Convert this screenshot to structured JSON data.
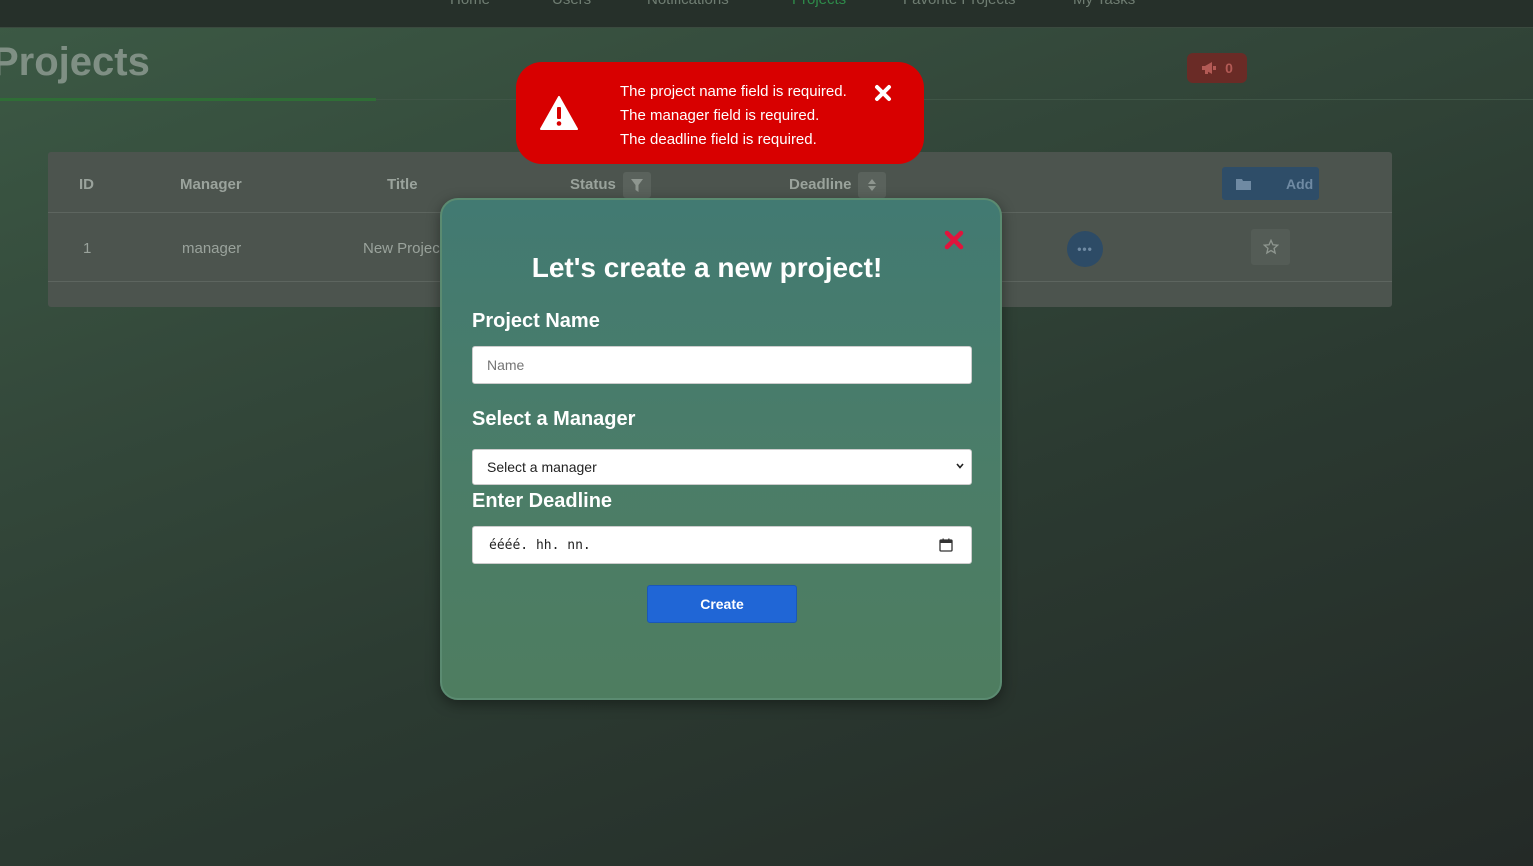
{
  "nav": {
    "items": [
      {
        "label": "Home",
        "active": false
      },
      {
        "label": "Users",
        "active": false
      },
      {
        "label": "Notifications",
        "active": false
      },
      {
        "label": "Projects",
        "active": true
      },
      {
        "label": "Favorite Projects",
        "active": false
      },
      {
        "label": "My Tasks",
        "active": false
      }
    ]
  },
  "header": {
    "title": "Projects",
    "announcement_count": "0"
  },
  "table": {
    "columns": [
      "ID",
      "Manager",
      "Title",
      "Status",
      "Deadline"
    ],
    "add_label": "Add",
    "rows": [
      {
        "id": "1",
        "manager": "manager",
        "title": "New Projec"
      }
    ]
  },
  "alert": {
    "messages": [
      "The project name field is required.",
      "The manager field is required.",
      "The deadline field is required."
    ]
  },
  "modal": {
    "title": "Let's create a new project!",
    "name_label": "Project Name",
    "name_placeholder": "Name",
    "manager_label": "Select a Manager",
    "manager_selected": "Select a manager",
    "deadline_label": "Enter Deadline",
    "deadline_placeholder": "éééé. hh. nn.",
    "create_label": "Create"
  },
  "colors": {
    "alert_bg": "#d80000",
    "modal_bg": "#4b7d68",
    "primary": "#2066d6",
    "close_icon": "#e0143c"
  },
  "icons": {
    "alert": "warning-triangle-icon",
    "alert_close": "close-x-icon",
    "modal_close": "close-x-icon",
    "status_filter": "filter-icon",
    "deadline_sort": "sort-icon",
    "add": "folder-icon",
    "more": "ellipsis-icon",
    "favorite": "star-icon",
    "announcement": "megaphone-icon",
    "calendar": "calendar-icon",
    "select": "chevron-down-icon"
  }
}
